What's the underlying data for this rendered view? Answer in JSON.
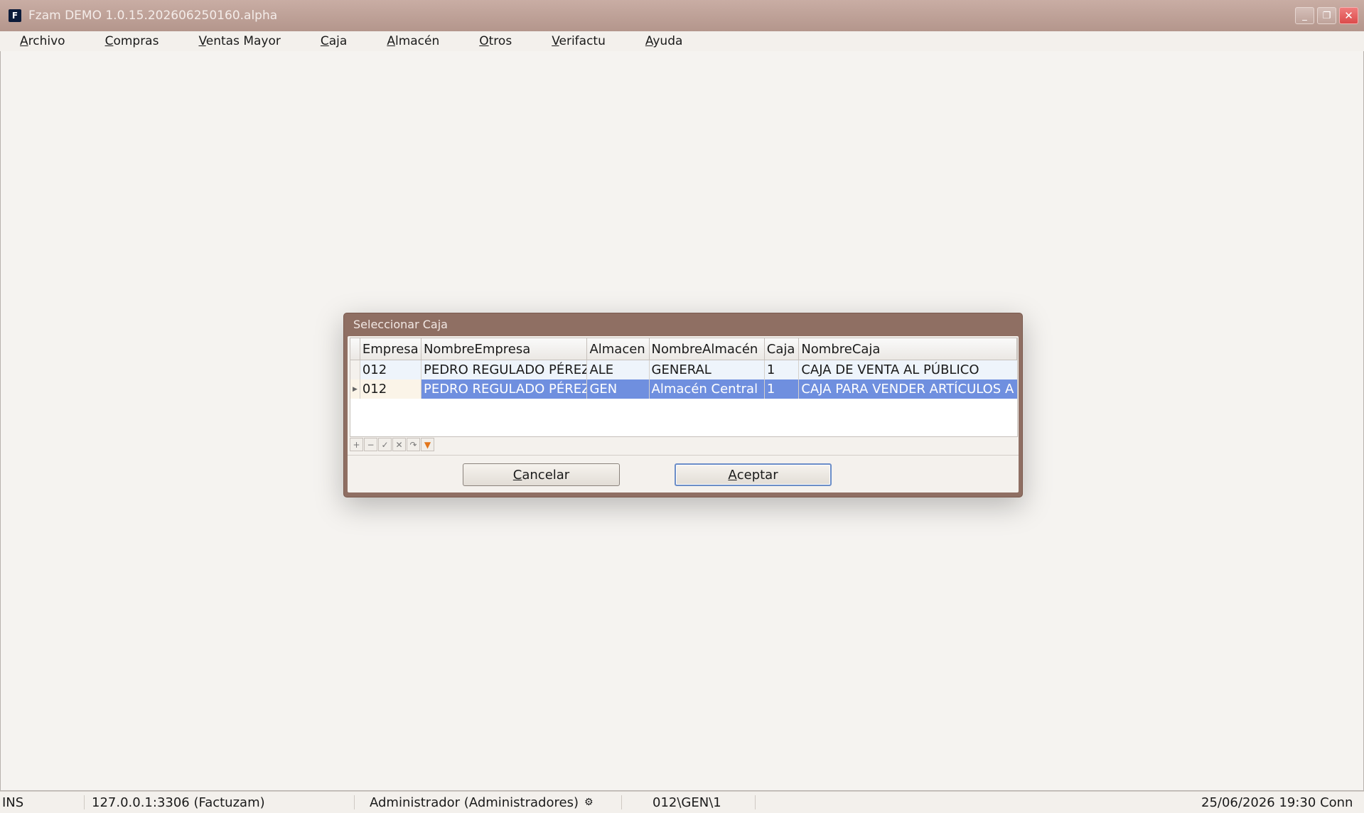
{
  "window": {
    "icon_letter": "F",
    "title": "Fzam DEMO 1.0.15.202606250160.alpha",
    "minimize": "_",
    "restore": "❐",
    "close": "✕"
  },
  "menu": [
    {
      "u": "A",
      "rest": "rchivo"
    },
    {
      "u": "C",
      "rest": "ompras"
    },
    {
      "u": "V",
      "rest": "entas Mayor"
    },
    {
      "u": "C",
      "rest": "aja"
    },
    {
      "u": "A",
      "pre": "",
      "rest": "lmacén"
    },
    {
      "u": "O",
      "rest": "tros"
    },
    {
      "u": "V",
      "rest": "erifactu"
    },
    {
      "u": "A",
      "rest": "yuda"
    }
  ],
  "dialog": {
    "title": "Seleccionar Caja",
    "columns": [
      "Empresa",
      "NombreEmpresa",
      "Almacen",
      "NombreAlmacén",
      "Caja",
      "NombreCaja"
    ],
    "rows": [
      {
        "indicator": "",
        "empresa": "012",
        "nombre_empresa": "PEDRO REGULADO PÉREZ",
        "almacen": "ALE",
        "nombre_almacen": "GENERAL",
        "caja": "1",
        "nombre_caja": "CAJA DE VENTA AL PÚBLICO"
      },
      {
        "indicator": "▶",
        "empresa": "012",
        "nombre_empresa": "PEDRO REGULADO PÉREZ",
        "almacen": "GEN",
        "nombre_almacen": "Almacén Central",
        "caja": "1",
        "nombre_caja": "CAJA PARA VENDER ARTÍCULOS A"
      }
    ],
    "nav": {
      "add": "+",
      "remove": "−",
      "post": "✓",
      "cancel": "✕",
      "refresh": "↷",
      "filter": "▼"
    },
    "cancel_u": "C",
    "cancel_rest": "ancelar",
    "accept_u": "A",
    "accept_rest": "ceptar"
  },
  "status": {
    "mode": "INS",
    "server": "127.0.0.1:3306 (Factuzam)",
    "user": "Administrador (Administradores)",
    "location": "012\\GEN\\1",
    "datetime": "25/06/2026 19:30 Conn"
  }
}
